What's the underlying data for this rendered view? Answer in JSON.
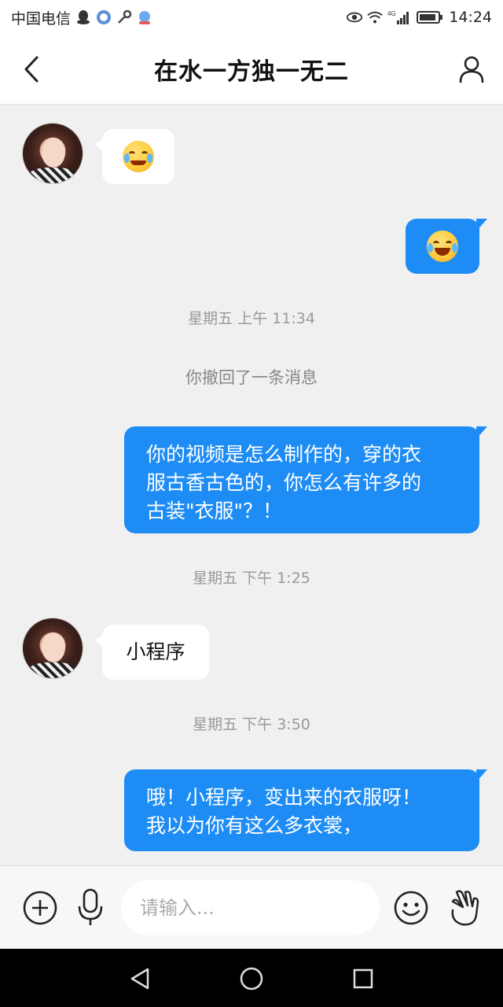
{
  "status_bar": {
    "carrier": "中国电信",
    "time": "14:24",
    "network": "4G",
    "icons_left": [
      "qq-icon",
      "baby-app-icon",
      "key-icon",
      "mascot-app-icon"
    ],
    "icons_right": [
      "eye-care-icon",
      "wifi-icon",
      "signal-icon",
      "battery-icon"
    ]
  },
  "header": {
    "title": "在水一方独一无二",
    "back_icon": "chevron-left-icon",
    "profile_icon": "person-icon"
  },
  "messages": [
    {
      "type": "incoming",
      "emoji": "crying-face"
    },
    {
      "type": "outgoing",
      "emoji": "tears-of-joy"
    },
    {
      "type": "timestamp",
      "text": "星期五 上午 11:34"
    },
    {
      "type": "system",
      "text": "你撤回了一条消息"
    },
    {
      "type": "outgoing",
      "lines": [
        "你的视频是怎么制作的，穿的衣",
        "服古香古色的，你怎么有许多的",
        "古装\"衣服\"？！"
      ]
    },
    {
      "type": "timestamp",
      "text": "星期五 下午 1:25"
    },
    {
      "type": "incoming",
      "text": "小程序"
    },
    {
      "type": "timestamp",
      "text": "星期五 下午 3:50"
    },
    {
      "type": "outgoing",
      "lines": [
        "哦！小程序，变出来的衣服呀！",
        "我以为你有这么多衣裳，"
      ]
    }
  ],
  "input_bar": {
    "placeholder": "请输入...",
    "value": "",
    "icons": [
      "plus-circle-icon",
      "microphone-icon",
      "emoji-icon",
      "gesture-icon"
    ]
  },
  "nav_bar": {
    "icons": [
      "back-triangle-icon",
      "home-circle-icon",
      "recents-square-icon"
    ]
  },
  "colors": {
    "outgoing_bubble": "#1e8cf5",
    "incoming_bubble": "#ffffff",
    "chat_background": "#f0f0f0",
    "timestamp_text": "#999999"
  }
}
